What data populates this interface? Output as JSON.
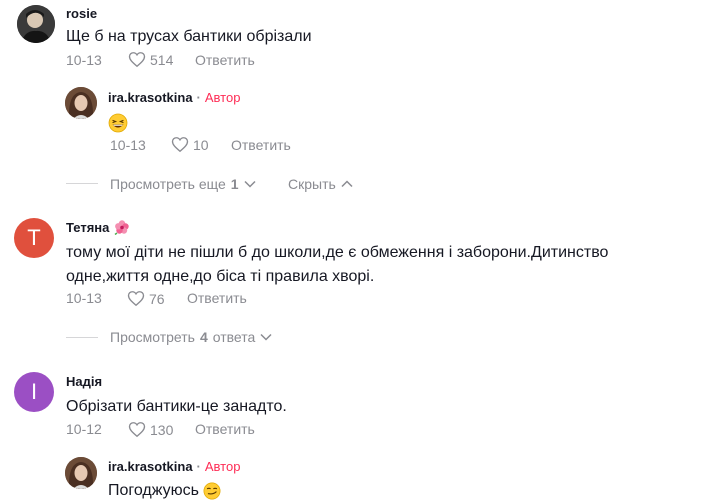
{
  "comments": [
    {
      "username": "rosie",
      "text": "Ще б на трусах бантики обрізали",
      "date": "10-13",
      "likes": "514",
      "reply_label": "Ответить",
      "replies": [
        {
          "username": "ira.krasotkina",
          "author_sep": "·",
          "author_label": "Автор",
          "text": "😂",
          "date": "10-13",
          "likes": "10",
          "reply_label": "Ответить"
        }
      ],
      "view_more": {
        "label": "Просмотреть еще",
        "count": "1"
      },
      "hide_label": "Скрыть"
    },
    {
      "username": "Тетяна",
      "username_emoji": "🌺",
      "avatar_letter": "T",
      "avatar_color": "#e0503d",
      "text_lines": [
        "тому мої діти не пішли б до школи,де є обмеження і заборони.Дитинство",
        "одне,життя одне,до біса ті правила хворі."
      ],
      "date": "10-13",
      "likes": "76",
      "reply_label": "Ответить",
      "view_more": {
        "label": "Просмотреть",
        "count": "4",
        "suffix": "ответа"
      }
    },
    {
      "username": "Надія",
      "avatar_letter": "I",
      "avatar_color": "#9b4fc4",
      "text": "Обрізати бантики-це занадто.",
      "date": "10-12",
      "likes": "130",
      "reply_label": "Ответить",
      "replies": [
        {
          "username": "ira.krasotkina",
          "author_sep": "·",
          "author_label": "Автор",
          "text": "Погоджуюсь",
          "emoji": "😏"
        }
      ]
    }
  ],
  "colors": {
    "author": "#fe2c55",
    "muted": "#8a8b91",
    "text": "#161823"
  },
  "icons": [
    "heart-outline-icon",
    "chevron-down-icon",
    "chevron-up-icon"
  ]
}
